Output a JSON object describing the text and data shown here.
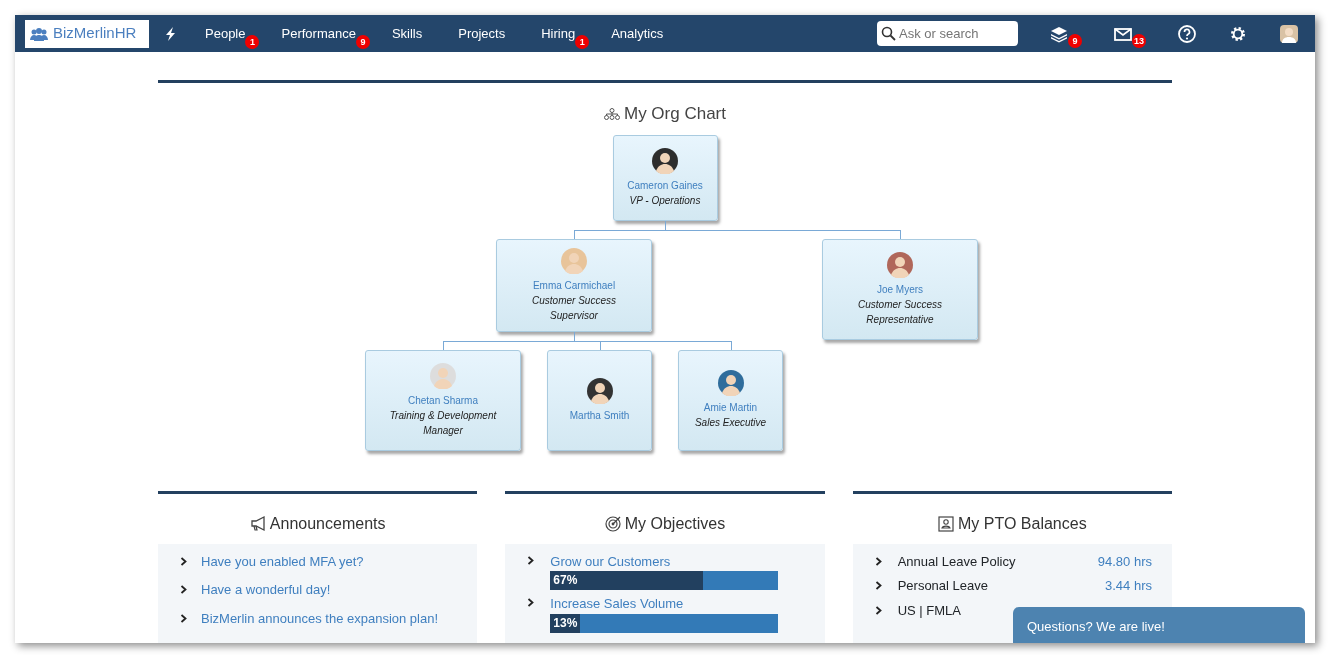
{
  "navbar": {
    "logo": "BizMerlinHR",
    "menu": [
      {
        "label": "People",
        "badge": "1"
      },
      {
        "label": "Performance",
        "badge": "9"
      },
      {
        "label": "Skills"
      },
      {
        "label": "Projects"
      },
      {
        "label": "Hiring",
        "badge": "1"
      },
      {
        "label": "Analytics"
      }
    ],
    "search": {
      "placeholder": "Ask or search"
    },
    "tools": [
      {
        "kind": "stack",
        "badge": "9"
      },
      {
        "kind": "mail",
        "badge": "13"
      },
      {
        "kind": "help"
      },
      {
        "kind": "settings"
      },
      {
        "kind": "avatar"
      }
    ]
  },
  "org_chart": {
    "title": "My Org Chart",
    "root": {
      "name": "Cameron Gaines",
      "role": "VP - Operations",
      "children": [
        {
          "name": "Emma Carmichael",
          "role": "Customer Success Supervisor",
          "children": [
            {
              "name": "Chetan Sharma",
              "role": "Training & Development Manager"
            },
            {
              "name": "Martha Smith"
            },
            {
              "name": "Amie Martin",
              "role": "Sales Executive"
            }
          ]
        },
        {
          "name": "Joe Myers",
          "role": "Customer Success Representative"
        }
      ]
    }
  },
  "panels": [
    {
      "kind": "announcements",
      "title": "Announcements",
      "items": [
        {
          "text": "Have you enabled MFA yet?"
        },
        {
          "text": "Have a wonderful day!"
        },
        {
          "text": "BizMerlin announces the expansion plan!"
        }
      ]
    },
    {
      "kind": "objectives",
      "title": "My Objectives",
      "items": [
        {
          "text": "Grow our Customers",
          "level": 0.67,
          "reading": "67%"
        },
        {
          "text": "Increase Sales Volume",
          "level": 0.13,
          "reading": "13%"
        }
      ]
    },
    {
      "kind": "pto",
      "title": "My PTO Balances",
      "items": [
        {
          "text": "Annual Leave Policy",
          "value": "94.80",
          "unit": "hrs"
        },
        {
          "text": "Personal Leave",
          "value": "3.44",
          "unit": "hrs"
        },
        {
          "text": "US | FMLA"
        }
      ]
    }
  ],
  "chat": {
    "label": "Questions? We are live!"
  }
}
